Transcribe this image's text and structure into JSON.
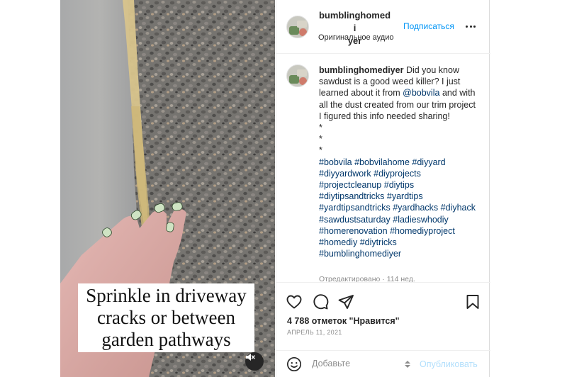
{
  "post": {
    "username_line1": "bumblinghomedi",
    "username_line2": "yer",
    "follow_label": "Подписаться",
    "audio_label": "Оригинальное аудио"
  },
  "media": {
    "overlay_lines": [
      "Sprinkle in driveway",
      "cracks or between",
      "garden pathways"
    ],
    "mute_icon": "speaker-muted-icon"
  },
  "comment": {
    "username": "bumblinghomediyer",
    "text_before_mention": "Did you know sawdust is a good weed killer? I just learned about it from",
    "mention": "@bobvila",
    "text_after_mention": "and with all the dust created from our trim project I figured this info needed sharing!",
    "stars": [
      "*",
      "*",
      "*"
    ],
    "hashtags": [
      "#bobvila",
      "#bobvilahome",
      "#diyyard",
      "#diyyardwork",
      "#diyprojects",
      "#projectcleanup",
      "#diytips",
      "#diytipsandtricks",
      "#yardtips",
      "#yardtipsandtricks",
      "#yardhacks",
      "#diyhack",
      "#sawdustsaturday",
      "#ladieswhodiy",
      "#homerenovation",
      "#homediyproject",
      "#homediy",
      "#diytricks",
      "#bumblinghomediyer"
    ],
    "meta": "Отредактировано · 114 нед."
  },
  "actions": {
    "icons": [
      "heart-icon",
      "comment-icon",
      "share-icon",
      "bookmark-icon"
    ],
    "likes": "4 788 отметок \"Нравится\"",
    "date": "АПРЕЛЬ 11, 2021"
  },
  "add_comment": {
    "placeholder": "Добавьте",
    "publish_label": "Опубликовать"
  },
  "colors": {
    "link": "#00376b",
    "follow": "#0095f6",
    "publish_disabled": "#b2dffc",
    "secondary_text": "#8e8e8e"
  }
}
